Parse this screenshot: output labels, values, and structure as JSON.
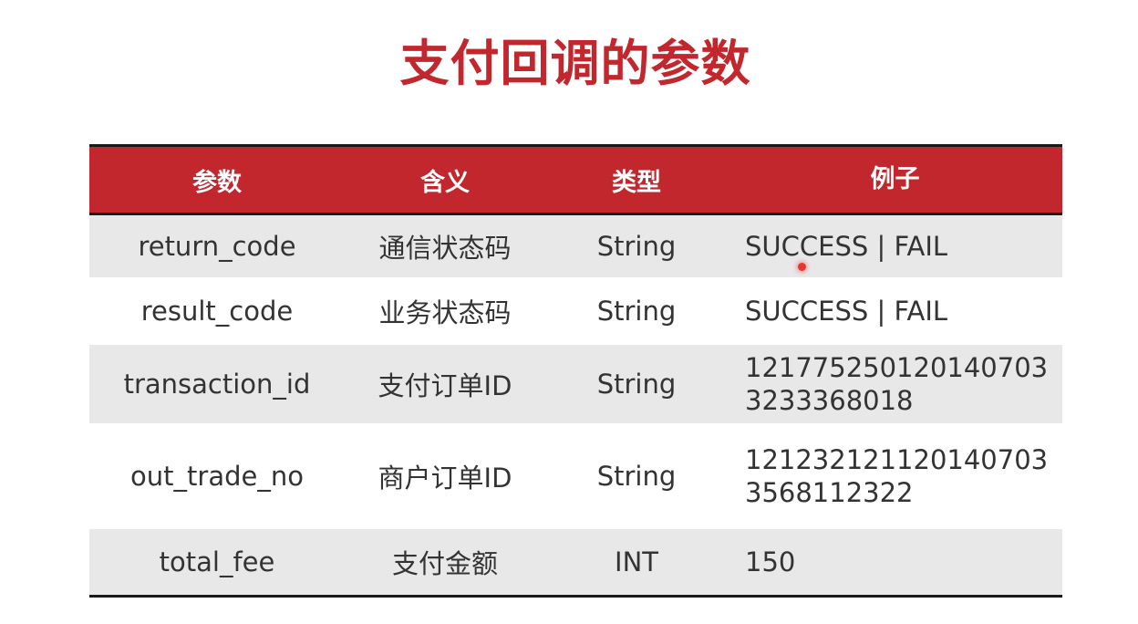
{
  "title": "支付回调的参数",
  "table": {
    "headers": {
      "name": "参数",
      "meaning": "含义",
      "type": "类型",
      "example": "例子"
    },
    "rows": [
      {
        "name": "return_code",
        "meaning": "通信状态码",
        "type": "String",
        "example_1": "SUCCESS | FAIL",
        "example_2": ""
      },
      {
        "name": "result_code",
        "meaning": "业务状态码",
        "type": "String",
        "example_1": "SUCCESS | FAIL",
        "example_2": ""
      },
      {
        "name": "transaction_id",
        "meaning": "支付订单ID",
        "type": "String",
        "example_1": "121775250120140703",
        "example_2": "3233368018"
      },
      {
        "name": "out_trade_no",
        "meaning": "商户订单ID",
        "type": "String",
        "example_1": "121232121120140703",
        "example_2": "3568112322"
      },
      {
        "name": "total_fee",
        "meaning": "支付金额",
        "type": "INT",
        "example_1": "150",
        "example_2": ""
      }
    ]
  },
  "colors": {
    "accent": "#c1272d",
    "row_shade": "#e8e8e8",
    "cursor": "#e8362e"
  }
}
